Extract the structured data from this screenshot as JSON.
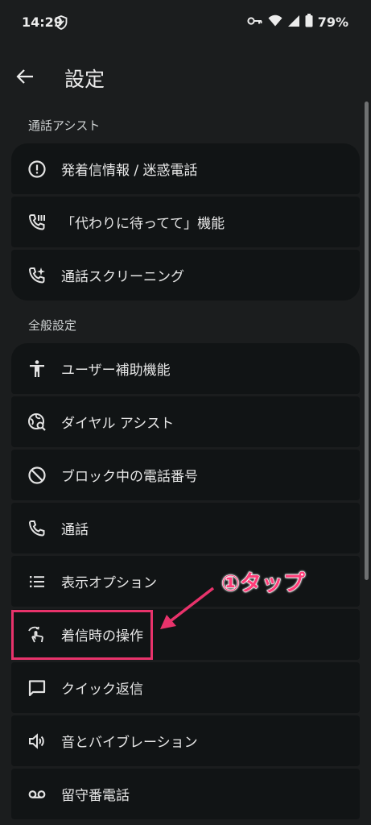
{
  "status_bar": {
    "time": "14:29",
    "battery": "79%"
  },
  "appbar": {
    "title": "設定"
  },
  "sections": [
    {
      "header": "通話アシスト",
      "items": [
        {
          "label": "発着信情報 / 迷惑電話",
          "icon": "alert-circle-icon"
        },
        {
          "label": "「代わりに待ってて」機能",
          "icon": "hold-for-me-icon"
        },
        {
          "label": "通話スクリーニング",
          "icon": "call-screen-icon"
        }
      ]
    },
    {
      "header": "全般設定",
      "items": [
        {
          "label": "ユーザー補助機能",
          "icon": "accessibility-icon"
        },
        {
          "label": "ダイヤル アシスト",
          "icon": "dial-assist-icon"
        },
        {
          "label": "ブロック中の電話番号",
          "icon": "block-icon"
        },
        {
          "label": "通話",
          "icon": "phone-icon"
        },
        {
          "label": "表示オプション",
          "icon": "list-icon"
        },
        {
          "label": "着信時の操作",
          "icon": "gesture-icon"
        },
        {
          "label": "クイック返信",
          "icon": "chat-icon"
        },
        {
          "label": "音とバイブレーション",
          "icon": "volume-icon"
        },
        {
          "label": "留守番電話",
          "icon": "voicemail-icon"
        }
      ]
    }
  ],
  "annotation": {
    "text": "①タップ",
    "color": "#ff3c78"
  },
  "colors": {
    "background": "#1b1d1e",
    "item_background": "#111415",
    "highlight": "#e8336b"
  }
}
